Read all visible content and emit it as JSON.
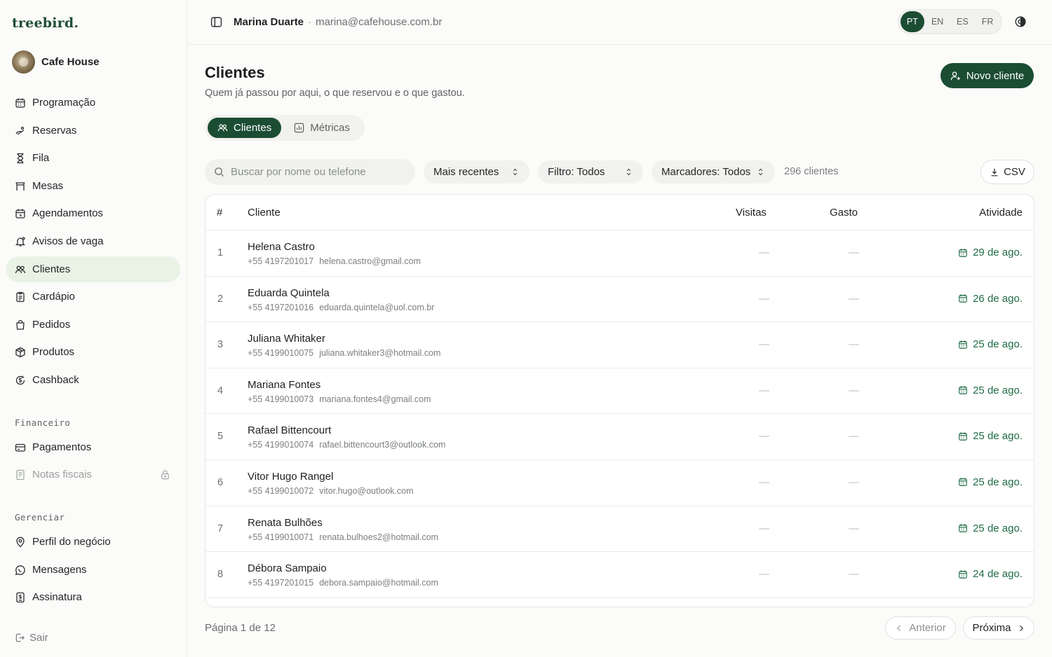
{
  "brand": "treebird.",
  "business": {
    "name": "Cafe House"
  },
  "nav": {
    "main": [
      {
        "label": "Programação",
        "icon": "calendar-icon"
      },
      {
        "label": "Reservas",
        "icon": "reservation-icon"
      },
      {
        "label": "Fila",
        "icon": "hourglass-icon"
      },
      {
        "label": "Mesas",
        "icon": "table-icon"
      },
      {
        "label": "Agendamentos",
        "icon": "calendar-clock-icon"
      },
      {
        "label": "Avisos de vaga",
        "icon": "bell-icon"
      },
      {
        "label": "Clientes",
        "icon": "users-icon"
      },
      {
        "label": "Cardápio",
        "icon": "menu-book-icon"
      },
      {
        "label": "Pedidos",
        "icon": "bag-icon"
      },
      {
        "label": "Produtos",
        "icon": "box-icon"
      },
      {
        "label": "Cashback",
        "icon": "cashback-icon"
      }
    ],
    "financeiro_title": "Financeiro",
    "financeiro": [
      {
        "label": "Pagamentos",
        "icon": "card-icon"
      },
      {
        "label": "Notas fiscais",
        "icon": "receipt-icon"
      }
    ],
    "gerenciar_title": "Gerenciar",
    "gerenciar": [
      {
        "label": "Perfil do negócio",
        "icon": "location-icon"
      },
      {
        "label": "Mensagens",
        "icon": "message-icon"
      },
      {
        "label": "Assinatura",
        "icon": "subscription-icon"
      }
    ],
    "logout": "Sair"
  },
  "header": {
    "user_name": "Marina Duarte",
    "user_email": "marina@cafehouse.com.br",
    "languages": [
      "PT",
      "EN",
      "ES",
      "FR"
    ],
    "active_language": "PT"
  },
  "page": {
    "title": "Clientes",
    "subtitle": "Quem já passou por aqui, o que reservou e o que gastou.",
    "new_button": "Novo cliente",
    "tabs": [
      "Clientes",
      "Métricas"
    ]
  },
  "filters": {
    "search_placeholder": "Buscar por nome ou telefone",
    "sort": "Mais recentes",
    "filter": "Filtro: Todos",
    "tags": "Marcadores: Todos",
    "count": "296 clientes",
    "export": "CSV"
  },
  "table": {
    "columns": [
      "#",
      "Cliente",
      "Visitas",
      "Gasto",
      "Atividade"
    ],
    "rows": [
      {
        "num": "1",
        "name": "Helena Castro",
        "phone": "+55 4197201017",
        "email": "helena.castro@gmail.com",
        "visits": "—",
        "spent": "—",
        "activity": "29 de ago."
      },
      {
        "num": "2",
        "name": "Eduarda Quintela",
        "phone": "+55 4197201016",
        "email": "eduarda.quintela@uol.com.br",
        "visits": "—",
        "spent": "—",
        "activity": "26 de ago."
      },
      {
        "num": "3",
        "name": "Juliana Whitaker",
        "phone": "+55 4199010075",
        "email": "juliana.whitaker3@hotmail.com",
        "visits": "—",
        "spent": "—",
        "activity": "25 de ago."
      },
      {
        "num": "4",
        "name": "Mariana Fontes",
        "phone": "+55 4199010073",
        "email": "mariana.fontes4@gmail.com",
        "visits": "—",
        "spent": "—",
        "activity": "25 de ago."
      },
      {
        "num": "5",
        "name": "Rafael Bittencourt",
        "phone": "+55 4199010074",
        "email": "rafael.bittencourt3@outlook.com",
        "visits": "—",
        "spent": "—",
        "activity": "25 de ago."
      },
      {
        "num": "6",
        "name": "Vitor Hugo Rangel",
        "phone": "+55 4199010072",
        "email": "vitor.hugo@outlook.com",
        "visits": "—",
        "spent": "—",
        "activity": "25 de ago."
      },
      {
        "num": "7",
        "name": "Renata Bulhões",
        "phone": "+55 4199010071",
        "email": "renata.bulhoes2@hotmail.com",
        "visits": "—",
        "spent": "—",
        "activity": "25 de ago."
      },
      {
        "num": "8",
        "name": "Débora Sampaio",
        "phone": "+55 4197201015",
        "email": "debora.sampaio@hotmail.com",
        "visits": "—",
        "spent": "—",
        "activity": "24 de ago."
      }
    ]
  },
  "pagination": {
    "label": "Página 1 de 12",
    "prev": "Anterior",
    "next": "Próxima"
  },
  "colors": {
    "primary": "#1b4d33",
    "active_nav": "#e8f3e5",
    "activity": "#1f6b45"
  }
}
